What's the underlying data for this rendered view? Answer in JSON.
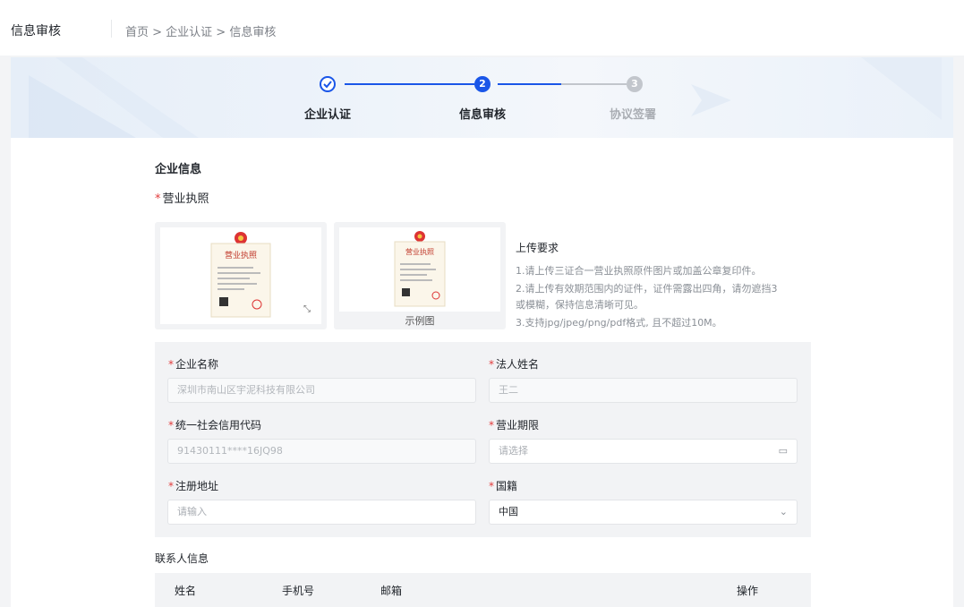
{
  "header": {
    "title": "信息审核",
    "breadcrumb": "首页 > 企业认证 > 信息审核"
  },
  "steps": [
    {
      "index": "✓",
      "label": "企业认证",
      "state": "done"
    },
    {
      "index": "2",
      "label": "信息审核",
      "state": "active"
    },
    {
      "index": "3",
      "label": "协议签署",
      "state": "pending"
    }
  ],
  "company": {
    "section_title": "企业信息",
    "license_label": "营业执照",
    "license_caption": "营业执照",
    "sample_caption": "示例图",
    "upload_requirements": {
      "title": "上传要求",
      "lines": [
        "1.请上传三证合一营业执照原件图片或加盖公章复印件。",
        "2.请上传有效期范围内的证件，证件需露出四角，请勿遮挡3",
        "或模糊，保持信息清晰可见。",
        "3.支持jpg/jpeg/png/pdf格式, 且不超过10M。"
      ]
    },
    "fields": {
      "company_name": {
        "label": "企业名称",
        "value": "深圳市南山区宇泥科技有限公司"
      },
      "legal_person": {
        "label": "法人姓名",
        "value": "王二"
      },
      "credit_code": {
        "label": "统一社会信用代码",
        "value": "91430111****16JQ98"
      },
      "business_term": {
        "label": "营业期限",
        "placeholder": "请选择"
      },
      "address": {
        "label": "注册地址",
        "placeholder": "请输入"
      },
      "nationality": {
        "label": "国籍",
        "value": "中国"
      }
    }
  },
  "contacts": {
    "section_title": "联系人信息",
    "columns": [
      "姓名",
      "手机号",
      "邮箱",
      "操作"
    ]
  },
  "colors": {
    "primary": "#1a56e8",
    "pending": "#c2c6cc",
    "required": "#e23b3b"
  },
  "icons": {
    "step_done": "check-circle-icon",
    "calendar": "calendar-icon",
    "dropdown": "chevron-down-icon",
    "expand": "expand-icon"
  }
}
